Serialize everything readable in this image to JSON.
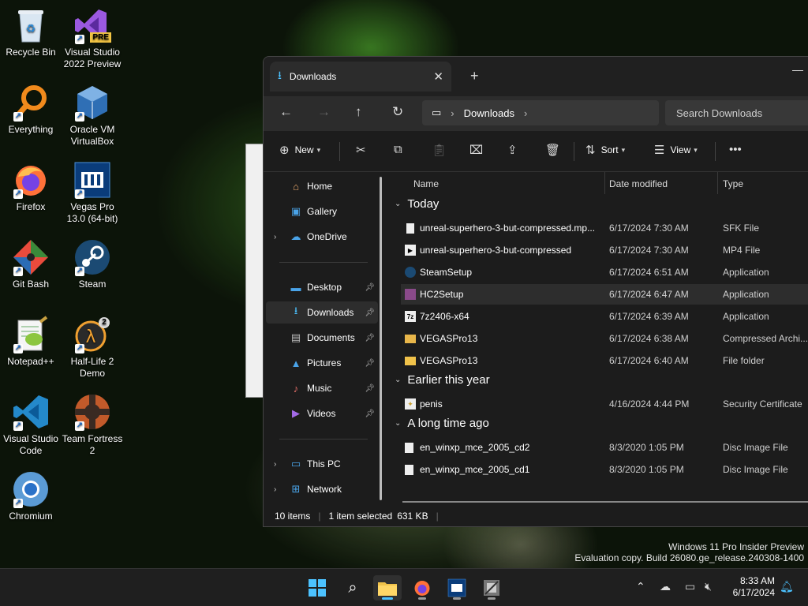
{
  "desktop": {
    "icons": [
      {
        "label": "Recycle Bin"
      },
      {
        "label": "Visual Studio 2022 Preview",
        "badge": "PRE"
      },
      {
        "label": "Everything"
      },
      {
        "label": "Oracle VM VirtualBox"
      },
      {
        "label": "Firefox"
      },
      {
        "label": "Vegas Pro 13.0 (64-bit)"
      },
      {
        "label": "Git Bash"
      },
      {
        "label": "Steam"
      },
      {
        "label": "Notepad++"
      },
      {
        "label": "Half-Life 2 Demo",
        "badge": "2"
      },
      {
        "label": "Visual Studio Code"
      },
      {
        "label": "Team Fortress 2"
      },
      {
        "label": "Chromium"
      }
    ]
  },
  "explorer": {
    "tab_title": "Downloads",
    "address": [
      "Downloads"
    ],
    "search_placeholder": "Search Downloads",
    "toolbar": {
      "new": "New",
      "sort": "Sort",
      "view": "View"
    },
    "sidebar": {
      "home": "Home",
      "gallery": "Gallery",
      "onedrive": "OneDrive",
      "desktop": "Desktop",
      "downloads": "Downloads",
      "documents": "Documents",
      "pictures": "Pictures",
      "music": "Music",
      "videos": "Videos",
      "thispc": "This PC",
      "network": "Network"
    },
    "columns": {
      "name": "Name",
      "date": "Date modified",
      "type": "Type"
    },
    "groups": {
      "today": "Today",
      "earlier": "Earlier this year",
      "longago": "A long time ago"
    },
    "files": [
      {
        "name": "unreal-superhero-3-but-compressed.mp...",
        "date": "6/17/2024 7:30 AM",
        "type": "SFK File"
      },
      {
        "name": "unreal-superhero-3-but-compressed",
        "date": "6/17/2024 7:30 AM",
        "type": "MP4 File"
      },
      {
        "name": "SteamSetup",
        "date": "6/17/2024 6:51 AM",
        "type": "Application"
      },
      {
        "name": "HC2Setup",
        "date": "6/17/2024 6:47 AM",
        "type": "Application"
      },
      {
        "name": "7z2406-x64",
        "date": "6/17/2024 6:39 AM",
        "type": "Application"
      },
      {
        "name": "VEGASPro13",
        "date": "6/17/2024 6:38 AM",
        "type": "Compressed Archi..."
      },
      {
        "name": "VEGASPro13",
        "date": "6/17/2024 6:40 AM",
        "type": "File folder"
      },
      {
        "name": "penis",
        "date": "4/16/2024 4:44 PM",
        "type": "Security Certificate"
      },
      {
        "name": "en_winxp_mce_2005_cd2",
        "date": "8/3/2020 1:05 PM",
        "type": "Disc Image File"
      },
      {
        "name": "en_winxp_mce_2005_cd1",
        "date": "8/3/2020 1:05 PM",
        "type": "Disc Image File"
      }
    ],
    "status": {
      "items": "10 items",
      "selected": "1 item selected",
      "size": "631 KB"
    }
  },
  "watermark": {
    "line1": "Windows 11 Pro Insider Preview",
    "line2": "Evaluation copy. Build 26080.ge_release.240308-1400"
  },
  "taskbar": {
    "time": "8:33 AM",
    "date": "6/17/2024"
  },
  "colors": {
    "accent": "#4cc2ff",
    "window_bg": "#1c1c1c",
    "selected_row": "#2d2d2d"
  }
}
